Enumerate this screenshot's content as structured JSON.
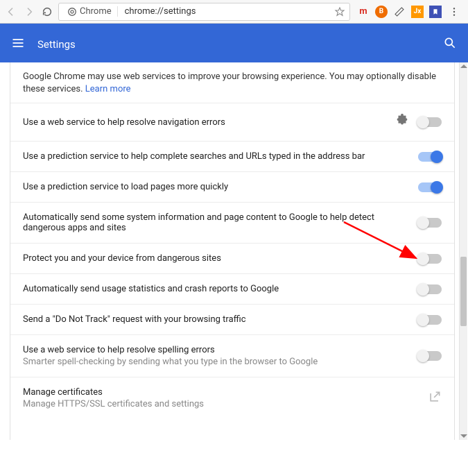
{
  "toolbar": {
    "scheme_label": "Chrome",
    "url": "chrome://settings"
  },
  "header": {
    "title": "Settings"
  },
  "intro": {
    "text": "Google Chrome may use web services to improve your browsing experience. You may optionally disable these services. ",
    "link": "Learn more"
  },
  "rows": [
    {
      "label": "Use a web service to help resolve navigation errors",
      "sub": "",
      "on": false,
      "puzzle": true
    },
    {
      "label": "Use a prediction service to help complete searches and URLs typed in the address bar",
      "sub": "",
      "on": true
    },
    {
      "label": "Use a prediction service to load pages more quickly",
      "sub": "",
      "on": true
    },
    {
      "label": "Automatically send some system information and page content to Google to help detect dangerous apps and sites",
      "sub": "",
      "on": false
    },
    {
      "label": "Protect you and your device from dangerous sites",
      "sub": "",
      "on": false
    },
    {
      "label": "Automatically send usage statistics and crash reports to Google",
      "sub": "",
      "on": false
    },
    {
      "label": "Send a \"Do Not Track\" request with your browsing traffic",
      "sub": "",
      "on": false
    },
    {
      "label": "Use a web service to help resolve spelling errors",
      "sub": "Smarter spell-checking by sending what you type in the browser to Google",
      "on": false
    },
    {
      "label": "Manage certificates",
      "sub": "Manage HTTPS/SSL certificates and settings",
      "on": null,
      "launch": true
    }
  ],
  "ext_icons": {
    "m": "m",
    "jx": "Jx"
  }
}
